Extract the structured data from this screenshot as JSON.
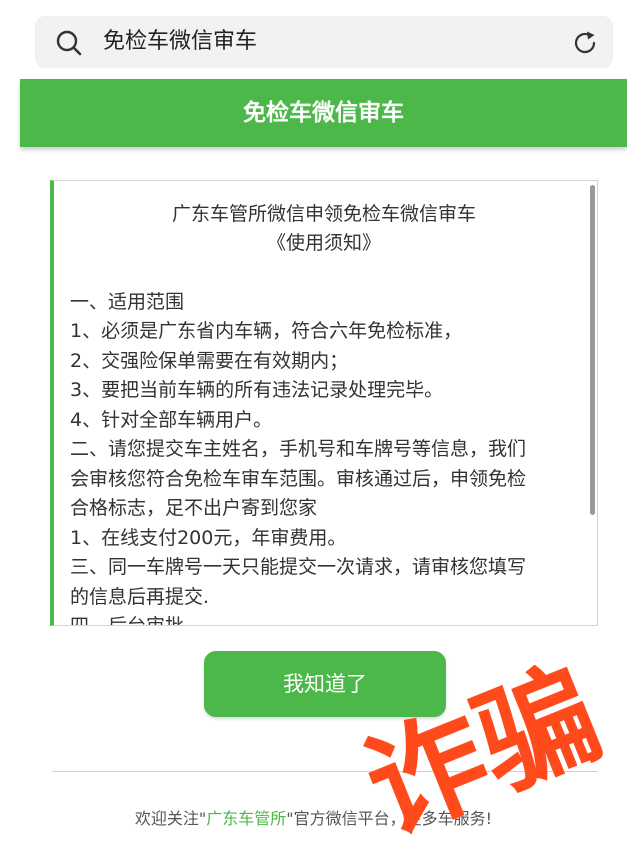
{
  "search": {
    "query": "免检车微信审车"
  },
  "header": {
    "title": "免检车微信审车"
  },
  "notice": {
    "title_lines": [
      "广东车管所微信申领免检车微信审车",
      "《使用须知》"
    ],
    "lines": [
      "一、适用范围",
      "1、必须是广东省内车辆，符合六年免检标准，",
      "2、交强险保单需要在有效期内；",
      "3、要把当前车辆的所有违法记录处理完毕。",
      "4、针对全部车辆用户。",
      "二、请您提交车主姓名，手机号和车牌号等信息，我们",
      "会审核您符合免检车审车范围。审核通过后，申领免检",
      "合格标志，足不出户寄到您家",
      "1、在线支付200元，年审费用。",
      "三、同一车牌号一天只能提交一次请求，请审核您填写",
      "的信息后再提交.",
      "四、后台审批"
    ]
  },
  "button": {
    "label": "我知道了"
  },
  "footer": {
    "prefix": "欢迎关注\"",
    "brand": "广东车管所",
    "suffix": "\"官方微信平台，更多车服务!"
  },
  "stamp": {
    "text": "诈骗"
  },
  "colors": {
    "accent": "#4cb849",
    "stamp": "#ff4a1c"
  }
}
